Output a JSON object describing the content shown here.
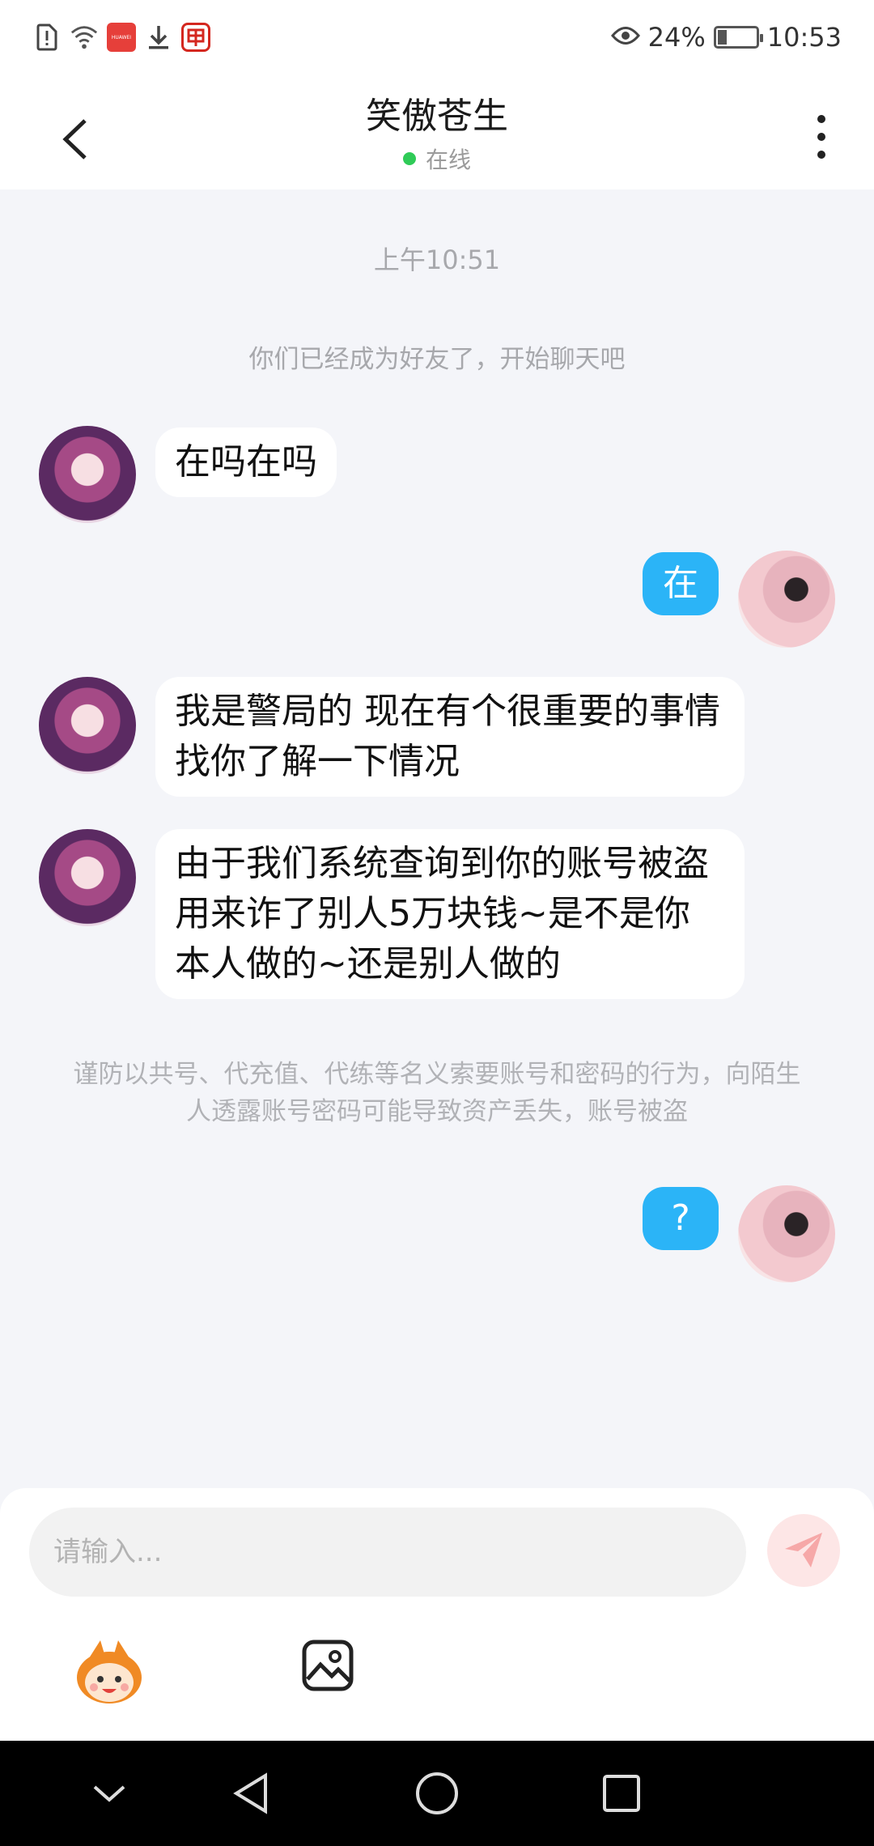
{
  "status_bar": {
    "battery_percent": "24%",
    "battery_level": 0.24,
    "time": "10:53",
    "huawei_label": "HUAWEI"
  },
  "header": {
    "title": "笑傲苍生",
    "presence": "在线",
    "presence_color": "#2fcb57"
  },
  "chat": {
    "timestamp": "上午10:51",
    "system_message": "你们已经成为好友了，开始聊天吧",
    "warning": "谨防以共号、代充值、代练等名义索要账号和密码的行为，向陌生人透露账号密码可能导致资产丢失，账号被盗",
    "messages": [
      {
        "from": "them",
        "text": "在吗在吗"
      },
      {
        "from": "me",
        "text": "在"
      },
      {
        "from": "them",
        "text": "我是警局的 现在有个很重要的事情找你了解一下情况"
      },
      {
        "from": "them",
        "text": "由于我们系统查询到你的账号被盗用来诈了别人5万块钱~是不是你本人做的~还是别人做的"
      },
      {
        "from": "me",
        "text": "?"
      }
    ]
  },
  "composer": {
    "placeholder": "请输入...",
    "send_icon": "paper-plane-icon",
    "emoji_icon": "mascot-emoji-icon",
    "image_icon": "image-icon"
  },
  "colors": {
    "outgoing_bubble": "#2bb4f7",
    "incoming_bubble": "#ffffff",
    "background": "#f4f5f9"
  }
}
